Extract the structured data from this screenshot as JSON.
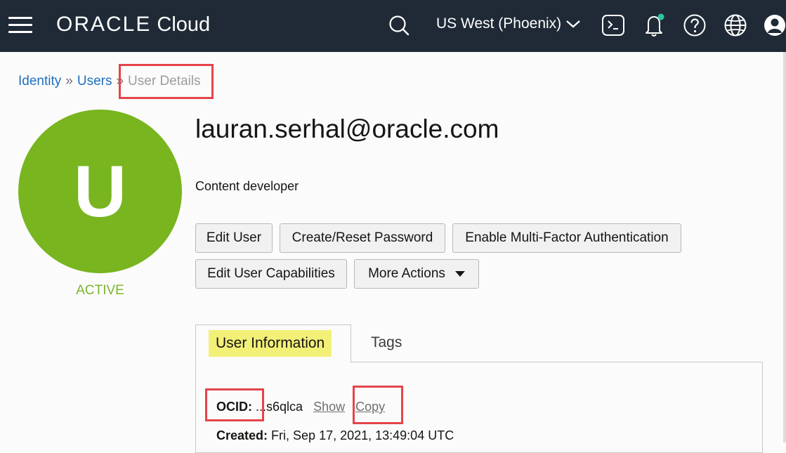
{
  "header": {
    "brand": "ORACLE",
    "product": "Cloud",
    "region": "US West (Phoenix)"
  },
  "breadcrumb": {
    "items": [
      "Identity",
      "Users"
    ],
    "separator": "»",
    "current": "User Details"
  },
  "user": {
    "avatar_letter": "U",
    "status": "ACTIVE",
    "name": "lauran.serhal@oracle.com",
    "description": "Content developer"
  },
  "actions": {
    "edit_user": "Edit User",
    "create_reset_password": "Create/Reset Password",
    "enable_mfa": "Enable Multi-Factor Authentication",
    "edit_capabilities": "Edit User Capabilities",
    "more_actions": "More Actions"
  },
  "tabs": {
    "user_information": "User Information",
    "tags": "Tags"
  },
  "details": {
    "ocid_label": "OCID:",
    "ocid_value": "...s6qlca",
    "show_link": "Show",
    "copy_link": "Copy",
    "created_label": "Created:",
    "created_value": "Fri, Sep 17, 2021, 13:49:04 UTC"
  },
  "colors": {
    "header_bg": "#1f2a36",
    "avatar_bg": "#78b51f",
    "status_green": "#7cb42e",
    "link_blue": "#1f6fbf",
    "highlight_box": "#e5444a",
    "tab_highlight": "#f3f078",
    "notification_dot": "#2fc5a3"
  }
}
